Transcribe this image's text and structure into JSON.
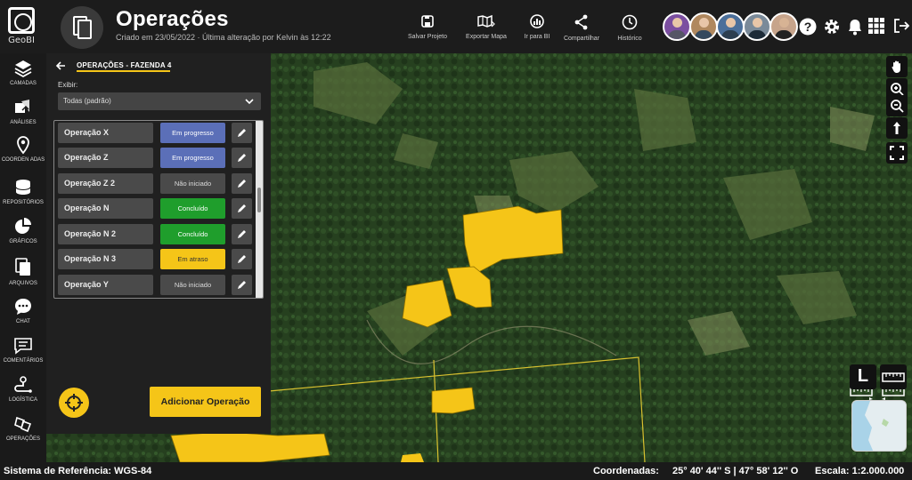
{
  "app": {
    "logo_text": "GeoBI"
  },
  "header": {
    "title": "Operações",
    "subtitle": "Criado em 23/05/2022 · Última alteração por Kelvin às 12:22",
    "tools": [
      {
        "label": "Salvar Projeto",
        "icon": "save-icon"
      },
      {
        "label": "Exportar Mapa",
        "icon": "export-map-icon"
      },
      {
        "label": "Ir para BI",
        "icon": "bi-chart-icon"
      },
      {
        "label": "Compartilhar",
        "icon": "share-icon"
      },
      {
        "label": "Histórico",
        "icon": "history-icon"
      }
    ],
    "avatar_count": 5,
    "right_icons": [
      "help-icon",
      "settings-gear-icon",
      "notification-bell-icon",
      "apps-grid-icon",
      "logout-icon"
    ]
  },
  "sidebar": {
    "items": [
      {
        "label": "CAMADAS",
        "icon": "layers-icon"
      },
      {
        "label": "ANÁLISES",
        "icon": "analysis-icon"
      },
      {
        "label": "COORDEN ADAS",
        "icon": "location-pin-icon"
      },
      {
        "label": "REPOSITÓRIOS",
        "icon": "database-icon"
      },
      {
        "label": "GRÁFICOS",
        "icon": "pie-chart-icon"
      },
      {
        "label": "ARQUIVOS",
        "icon": "files-icon"
      },
      {
        "label": "CHAT",
        "icon": "chat-icon"
      },
      {
        "label": "COMENTÁRIOS",
        "icon": "comments-icon"
      },
      {
        "label": "LOGÍSTICA",
        "icon": "logistics-route-icon"
      },
      {
        "label": "OPERAÇÕES",
        "icon": "operations-icon"
      }
    ]
  },
  "panel": {
    "title": "OPERAÇÕES - FAZENDA 4",
    "filter_label": "Exibir:",
    "filter_value": "Todas (padrão)",
    "operations": [
      {
        "name": "Operação X",
        "status": "Em progresso",
        "status_color": "#5b6fb8"
      },
      {
        "name": "Operação Z",
        "status": "Em progresso",
        "status_color": "#5b6fb8"
      },
      {
        "name": "Operação Z 2",
        "status": "Não iniciado",
        "status_color": "#4a4a4a"
      },
      {
        "name": "Operação N",
        "status": "Concluído",
        "status_color": "#1f9e2c"
      },
      {
        "name": "Operação N 2",
        "status": "Concluído",
        "status_color": "#1f9e2c"
      },
      {
        "name": "Operação N 3",
        "status": "Em atraso",
        "status_color": "#f5c518"
      },
      {
        "name": "Operação Y",
        "status": "Não iniciado",
        "status_color": "#4a4a4a"
      }
    ],
    "add_button": "Adicionar Operação"
  },
  "map": {
    "controls": [
      "pan-hand-icon",
      "zoom-in-icon",
      "zoom-out-icon",
      "north-arrow-icon",
      "fullscreen-icon"
    ],
    "scale_toggle": "L",
    "highlight_color": "#f5c518"
  },
  "status": {
    "reference_system": "Sistema de Referência: WGS-84",
    "coordinates_label": "Coordenadas:",
    "coordinates_value": "25° 40' 44'' S | 47° 58' 12'' O",
    "scale": "Escala: 1:2.000.000"
  }
}
